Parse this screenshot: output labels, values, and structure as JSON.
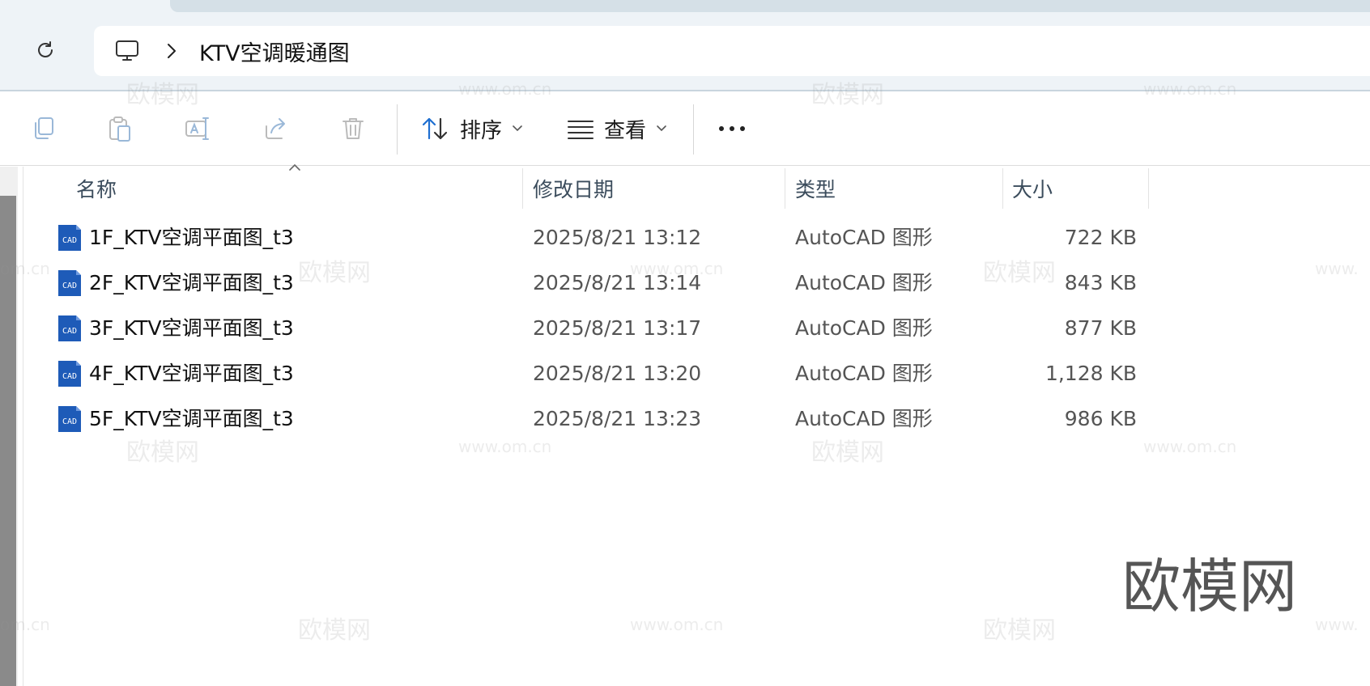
{
  "breadcrumb": {
    "current": "KTV空调暖通图"
  },
  "toolbar": {
    "sort_label": "排序",
    "view_label": "查看",
    "icons": [
      "copy-icon",
      "paste-icon",
      "rename-icon",
      "share-icon",
      "delete-icon",
      "sort-icon",
      "view-icon",
      "more-icon"
    ]
  },
  "columns": {
    "name": "名称",
    "date": "修改日期",
    "type": "类型",
    "size": "大小"
  },
  "files": [
    {
      "name": "1F_KTV空调平面图_t3",
      "date": "2025/8/21 13:12",
      "type": "AutoCAD 图形",
      "size": "722 KB"
    },
    {
      "name": "2F_KTV空调平面图_t3",
      "date": "2025/8/21 13:14",
      "type": "AutoCAD 图形",
      "size": "843 KB"
    },
    {
      "name": "3F_KTV空调平面图_t3",
      "date": "2025/8/21 13:17",
      "type": "AutoCAD 图形",
      "size": "877 KB"
    },
    {
      "name": "4F_KTV空调平面图_t3",
      "date": "2025/8/21 13:20",
      "type": "AutoCAD 图形",
      "size": "1,128 KB"
    },
    {
      "name": "5F_KTV空调平面图_t3",
      "date": "2025/8/21 13:23",
      "type": "AutoCAD 图形",
      "size": "986 KB"
    }
  ],
  "file_icon_text": "CAD",
  "watermark": {
    "brand": "欧模网",
    "url": "www.om.cn",
    "url_partial_left": "om.cn",
    "url_partial_right": "www."
  },
  "colors": {
    "accent": "#1f6fd1",
    "cad_icon": "#1e5bb8",
    "header_text": "#3b4c5c"
  }
}
